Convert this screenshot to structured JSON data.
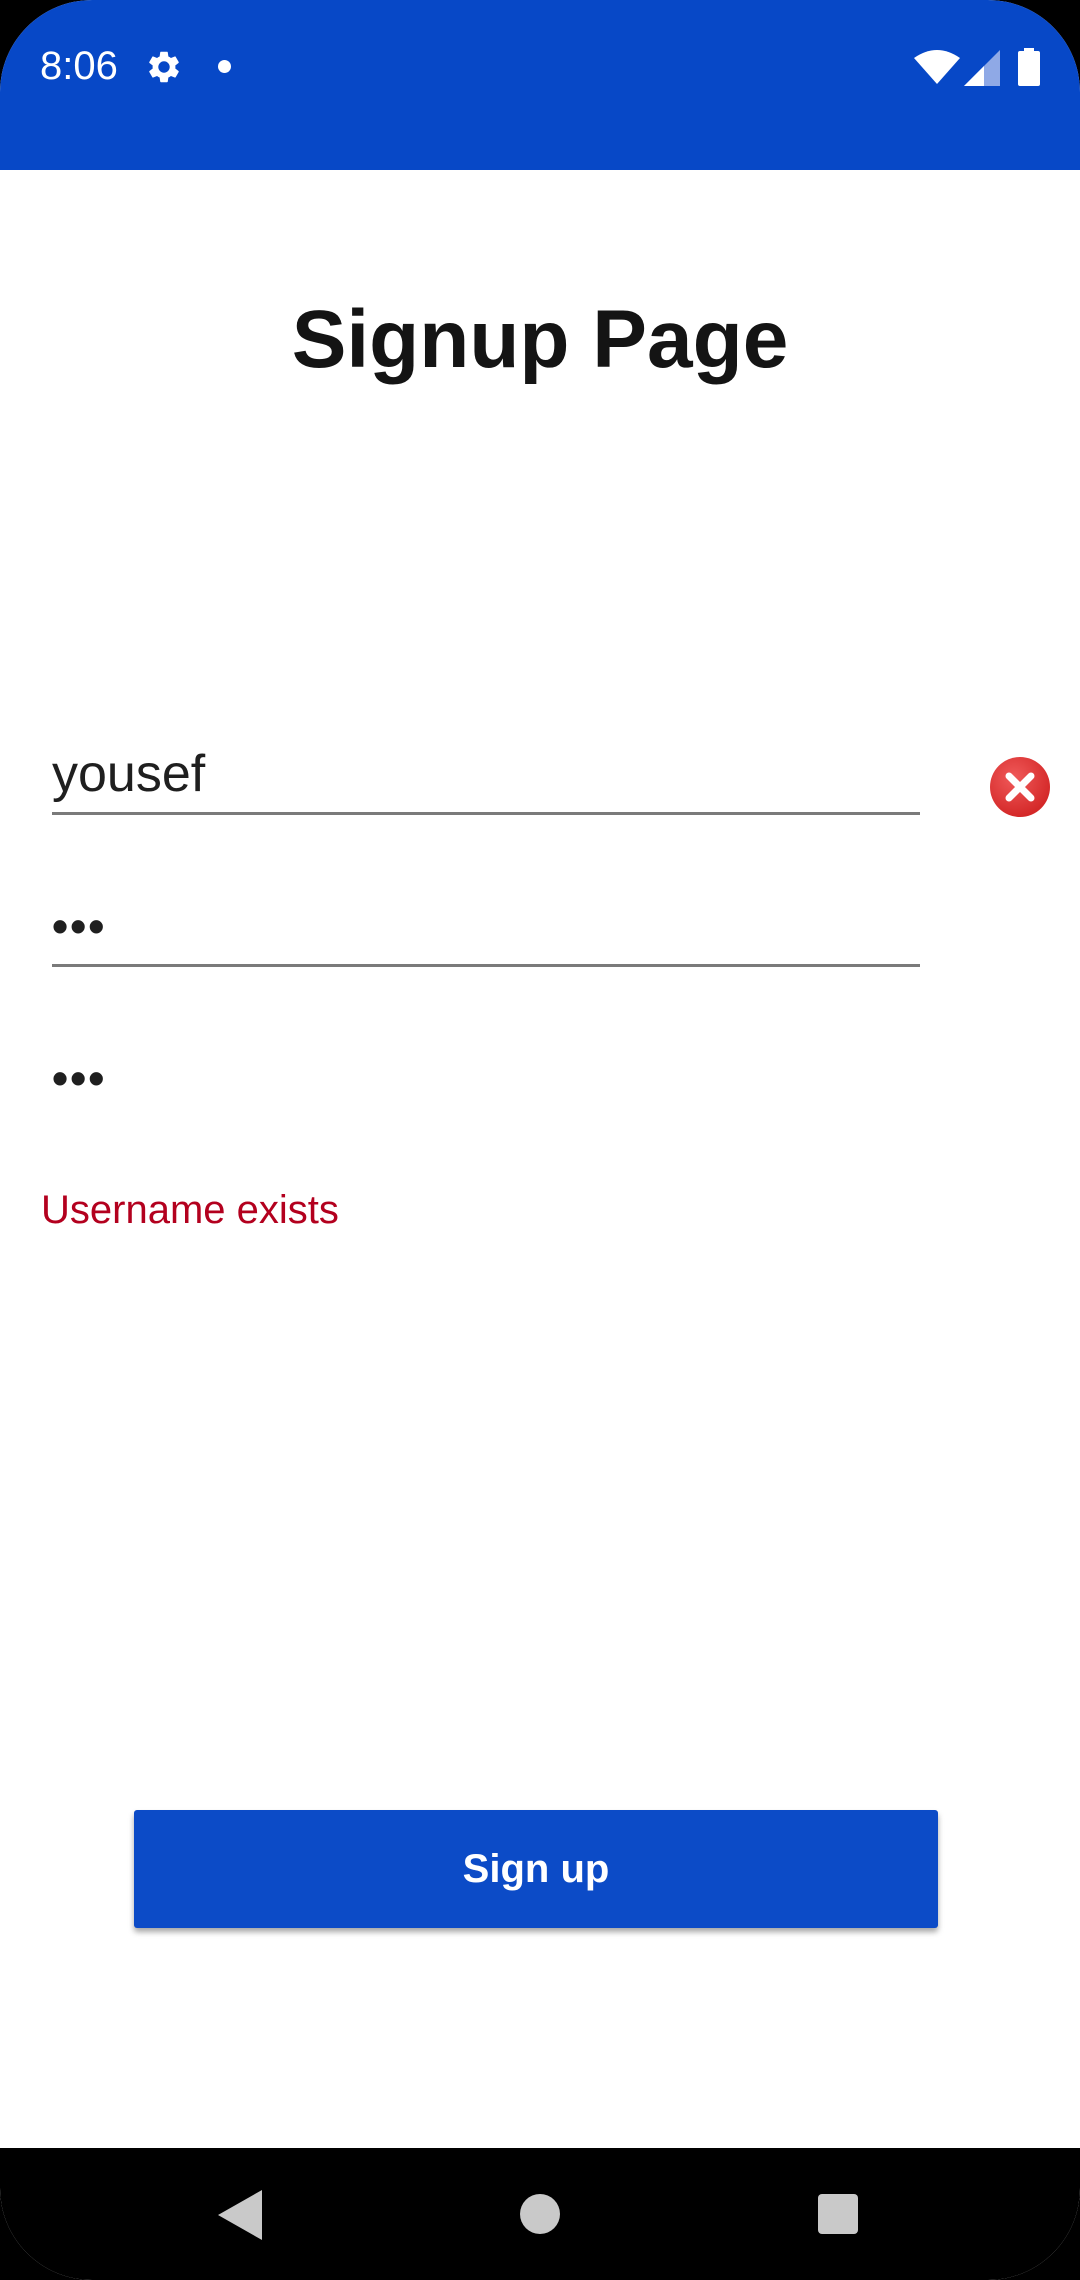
{
  "status_bar": {
    "time": "8:06",
    "background_color": "#0748c7",
    "icons": [
      "gear-icon",
      "notification-dot-icon",
      "wifi-icon",
      "cellular-signal-icon",
      "battery-icon"
    ]
  },
  "page": {
    "title": "Signup Page"
  },
  "form": {
    "username_value": "yousef",
    "password_value": "•••",
    "confirm_password_value": "•••",
    "username_error_icon": "error-circle-x-icon",
    "error_message": "Username exists",
    "error_color": "#b3001e"
  },
  "actions": {
    "signup_label": "Sign up",
    "signup_color": "#0c4bc7"
  },
  "nav_bar": {
    "icons": [
      "back-triangle-icon",
      "home-circle-icon",
      "recents-square-icon"
    ]
  }
}
